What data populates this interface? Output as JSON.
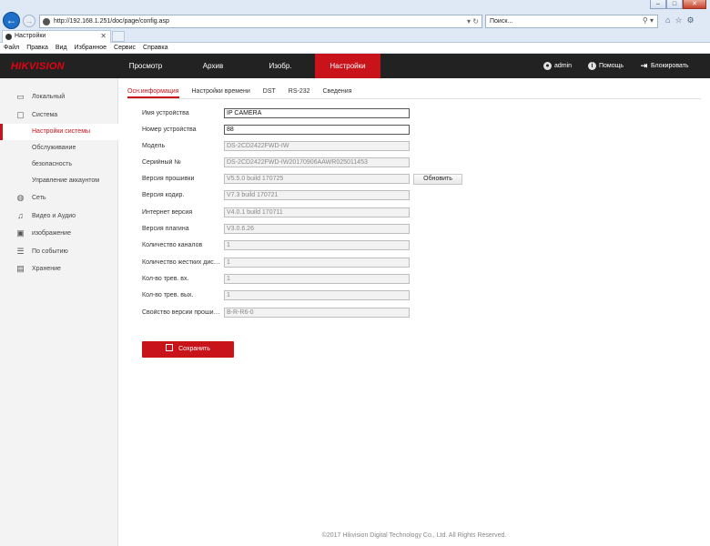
{
  "browser": {
    "url": "http://192.168.1.251/doc/page/config.asp",
    "search_placeholder": "Поиск...",
    "tab_title": "Настройки",
    "menu": [
      "Файл",
      "Правка",
      "Вид",
      "Избранное",
      "Сервис",
      "Справка"
    ]
  },
  "app": {
    "logo": "HIKVISION",
    "nav": [
      "Просмотр",
      "Архив",
      "Изобр.",
      "Настройки"
    ],
    "active_nav": "Настройки",
    "user": "admin",
    "help": "Помощь",
    "logout": "Блокировать"
  },
  "sidebar": {
    "items": [
      {
        "label": "Локальный",
        "icon": "monitor-icon"
      },
      {
        "label": "Система",
        "icon": "system-icon"
      },
      {
        "label": "Настройки системы",
        "icon": ""
      },
      {
        "label": "Обслуживание",
        "icon": ""
      },
      {
        "label": "безопасность",
        "icon": ""
      },
      {
        "label": "Управление аккаунтом",
        "icon": ""
      },
      {
        "label": "Сеть",
        "icon": "globe-icon"
      },
      {
        "label": "Видео и Аудио",
        "icon": "audio-video-icon"
      },
      {
        "label": "изображение",
        "icon": "image-icon"
      },
      {
        "label": "По событию",
        "icon": "event-icon"
      },
      {
        "label": "Хранение",
        "icon": "storage-icon"
      }
    ],
    "active": "Настройки системы"
  },
  "subtabs": [
    "Осн.информация",
    "Настройки времени",
    "DST",
    "RS-232",
    "Сведения"
  ],
  "active_subtab": "Осн.информация",
  "form": {
    "device_name": {
      "label": "Имя устройства",
      "value": "IP CAMERA"
    },
    "device_no": {
      "label": "Номер устройства",
      "value": "88"
    },
    "model": {
      "label": "Модель",
      "value": "DS-2CD2422FWD-IW"
    },
    "serial": {
      "label": "Серийный №",
      "value": "DS-2CD2422FWD-IW20170906AAWR025011453"
    },
    "firmware": {
      "label": "Версия прошивки",
      "value": "V5.5.0 build 170725"
    },
    "encoding": {
      "label": "Версия кодир.",
      "value": "V7.3 build 170721"
    },
    "web": {
      "label": "Интернет версия",
      "value": "V4.0.1 build 170711"
    },
    "plugin": {
      "label": "Версия плагина",
      "value": "V3.0.6.26"
    },
    "channels": {
      "label": "Количество каналов",
      "value": "1"
    },
    "hdd": {
      "label": "Количество жестких дисков",
      "value": "1"
    },
    "alarm_in": {
      "label": "Кол-во трев. вх.",
      "value": "1"
    },
    "alarm_out": {
      "label": "Кол-во трев. вых.",
      "value": "1"
    },
    "fw_property": {
      "label": "Свойство версии прошивки",
      "value": "B-R-R6-0"
    }
  },
  "update_button": "Обновить",
  "save_button": "Сохранить",
  "footer": "©2017 Hikvision Digital Technology Co., Ltd. All Rights Reserved."
}
